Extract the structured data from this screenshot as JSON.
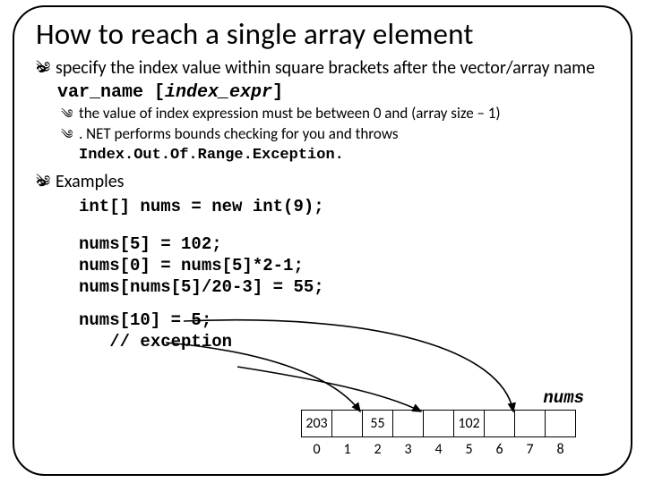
{
  "title": "How to reach a single array element",
  "p1": {
    "line": "specify the index value within square brackets after the vector/array name",
    "code": "var_name [",
    "code_italic": "index_expr",
    "code_end": "]"
  },
  "sub1": "the value of index expression must be between 0 and (array size – 1)",
  "sub2_a": ". NET performs bounds checking for you and throws ",
  "sub2_b": "Index.Out.Of.Range.Exception.",
  "examples_label": "Examples",
  "code1": "int[] nums = new int(9);",
  "code2": "nums[5] = 102;\nnums[0] = nums[5]*2-1;\nnums[nums[5]/20-3] = 55;",
  "code3": "nums[10] = 5;\n   // exception",
  "array": {
    "label": "nums",
    "cells": [
      "203",
      "",
      "55",
      "",
      "",
      "102",
      "",
      "",
      ""
    ],
    "indices": [
      "0",
      "1",
      "2",
      "3",
      "4",
      "5",
      "6",
      "7",
      "8"
    ]
  }
}
